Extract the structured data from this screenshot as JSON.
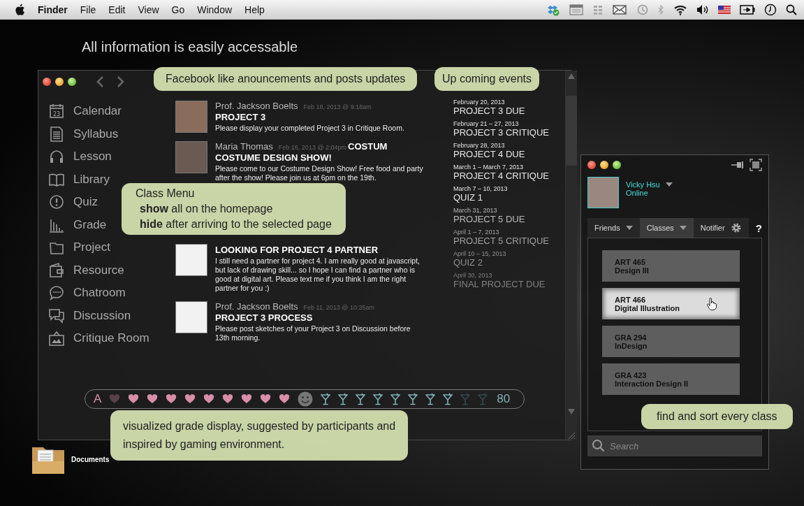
{
  "menu_bar": {
    "app": "Finder",
    "menus": [
      "File",
      "Edit",
      "View",
      "Go",
      "Window",
      "Help"
    ]
  },
  "headline": "All information is easily accessable",
  "desktop_icons": [
    {
      "label": "Documents",
      "kind": "docs"
    }
  ],
  "main_window": {
    "sidebar": [
      {
        "label": "Calendar",
        "kind": "calendar",
        "badge": "23"
      },
      {
        "label": "Syllabus",
        "kind": "document"
      },
      {
        "label": "Lesson",
        "kind": "headphones"
      },
      {
        "label": "Library",
        "kind": "book"
      },
      {
        "label": "Quiz",
        "kind": "alert"
      },
      {
        "label": "Grade",
        "kind": "chart"
      },
      {
        "label": "Project",
        "kind": "folder"
      },
      {
        "label": "Resource",
        "kind": "wallet"
      },
      {
        "label": "Chatroom",
        "kind": "chat"
      },
      {
        "label": "Discussion",
        "kind": "discussion"
      },
      {
        "label": "Critique Room",
        "kind": "picture"
      }
    ],
    "posts": [
      {
        "author": "Prof. Jackson Boelts",
        "date": "Feb 18, 2013 @ 9:18am",
        "title": "PROJECT 3",
        "body": "Please display your completed Project 3 in Critique Room."
      },
      {
        "author": "Maria Thomas",
        "date": "Feb 16, 2013 @ 2:04pm",
        "extra": "COSTUM",
        "title": "COSTUME DESIGN SHOW!",
        "body": "Please come to our Costume Design Show! Free food and party after the show! Please join us at 6pm on the 19th."
      },
      {
        "title": "LOOKING FOR PROJECT 4 PARTNER",
        "body": "I still need a partner for project 4. I am really good at javascript, but lack of drawing skill... so I hope I can find a partner who is good at digital art. Please text me if you think I am the right partner for you :)"
      },
      {
        "author": "Prof. Jackson Boelts",
        "date": "Feb 11, 2013 @ 10:35am",
        "title": "PROJECT 3 PROCESS",
        "body": "Please post sketches of your Project 3 on Discussion before 13th morning."
      }
    ],
    "events": [
      {
        "date": "February 20, 2013",
        "title": "PROJECT 3 DUE"
      },
      {
        "date": "February 21 – 27, 2013",
        "title": "PROJECT 3 CRITIQUE"
      },
      {
        "date": "February 28, 2013",
        "title": "PROJECT 4 DUE"
      },
      {
        "date": "March 1 – March 7, 2013",
        "title": "PROJECT 4 CRITIQUE"
      },
      {
        "date": "March 7 – 10, 2013",
        "title": "QUIZ 1"
      },
      {
        "date": "March 31, 2013",
        "title": "PROJECT 5 DUE"
      },
      {
        "date": "April 1 – 7, 2013",
        "title": "PROJECT 5 CRITIQUE"
      },
      {
        "date": "April 10 – 15, 2013",
        "title": "QUIZ 2"
      },
      {
        "date": "April 30, 2013",
        "title": "FINAL PROJECT DUE"
      }
    ],
    "grade_bar": {
      "letter": "A",
      "hearts": [
        {
          "filled": false
        },
        {
          "filled": true
        },
        {
          "filled": true
        },
        {
          "filled": true
        },
        {
          "filled": true
        },
        {
          "filled": true
        },
        {
          "filled": true
        },
        {
          "filled": true
        },
        {
          "filled": true
        },
        {
          "filled": true
        }
      ],
      "glasses": [
        {
          "filled": true
        },
        {
          "filled": true
        },
        {
          "filled": true
        },
        {
          "filled": true
        },
        {
          "filled": true
        },
        {
          "filled": true
        },
        {
          "filled": true
        },
        {
          "filled": true
        },
        {
          "filled": false
        },
        {
          "filled": false
        }
      ],
      "score": "80"
    }
  },
  "widget": {
    "user": {
      "name": "Vicky Hsu",
      "status": "Online"
    },
    "tabs": [
      {
        "label": "Friends",
        "selected": false,
        "kind": "dropdown"
      },
      {
        "label": "Classes",
        "selected": true,
        "kind": "dropdown"
      },
      {
        "label": "Notifier",
        "selected": false,
        "kind": "settings"
      }
    ],
    "help": "?",
    "classes": [
      {
        "code": "ART 465",
        "name": "Design III",
        "hovered": false
      },
      {
        "code": "ART 466",
        "name": "Digital Illustration",
        "hovered": true
      },
      {
        "code": "GRA 294",
        "name": "InDesign",
        "hovered": false
      },
      {
        "code": "GRA 423",
        "name": "Interaction Design II",
        "hovered": false
      }
    ],
    "search": {
      "placeholder": "Search"
    }
  },
  "callouts": [
    {
      "kind": "posts",
      "lines": [
        "Facebook like anouncements and posts updates"
      ]
    },
    {
      "kind": "events",
      "lines": [
        "Up coming events"
      ]
    },
    {
      "kind": "menu",
      "lines": [
        "Class Menu",
        "**show** all on the homepage",
        "**hide** after arriving to the selected page"
      ]
    },
    {
      "kind": "grade",
      "lines": [
        "visualized grade display, suggested by participants and",
        "inspired by gaming environment."
      ]
    },
    {
      "kind": "classes",
      "lines": [
        "find and sort every class"
      ]
    }
  ]
}
